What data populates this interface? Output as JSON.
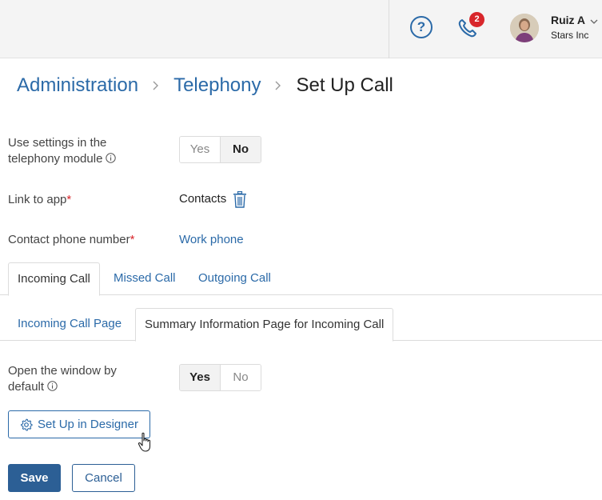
{
  "header": {
    "user": {
      "name": "Ruiz A",
      "company": "Stars Inc"
    },
    "notifications": {
      "count": "2"
    },
    "icons": {
      "help": "help-icon",
      "phone": "phone-icon",
      "user_menu": "chevron-down-icon"
    }
  },
  "breadcrumb": {
    "items": [
      "Administration",
      "Telephony"
    ],
    "current": "Set Up Call"
  },
  "form": {
    "use_settings": {
      "label_line1": "Use settings in the",
      "label_line2": "telephony module",
      "options": [
        "Yes",
        "No"
      ],
      "selected": "No"
    },
    "link_to_app": {
      "label": "Link to app",
      "required_mark": "*",
      "value": "Contacts"
    },
    "contact_phone": {
      "label": "Contact phone number",
      "required_mark": "*",
      "value": "Work phone"
    },
    "open_window": {
      "label_line1": "Open the window by",
      "label_line2": "default",
      "options": [
        "Yes",
        "No"
      ],
      "selected": "Yes"
    }
  },
  "tabs": {
    "main": [
      "Incoming Call",
      "Missed Call",
      "Outgoing Call"
    ],
    "main_active": "Incoming Call",
    "sub": [
      "Incoming Call Page",
      "Summary Information Page for Incoming Call"
    ],
    "sub_active": "Summary Information Page for Incoming Call"
  },
  "buttons": {
    "designer": "Set Up in Designer",
    "save": "Save",
    "cancel": "Cancel"
  },
  "colors": {
    "accent": "#2b6aa8",
    "primary_button": "#2c5f95",
    "required": "#d8262b",
    "badge": "#d8262b"
  }
}
